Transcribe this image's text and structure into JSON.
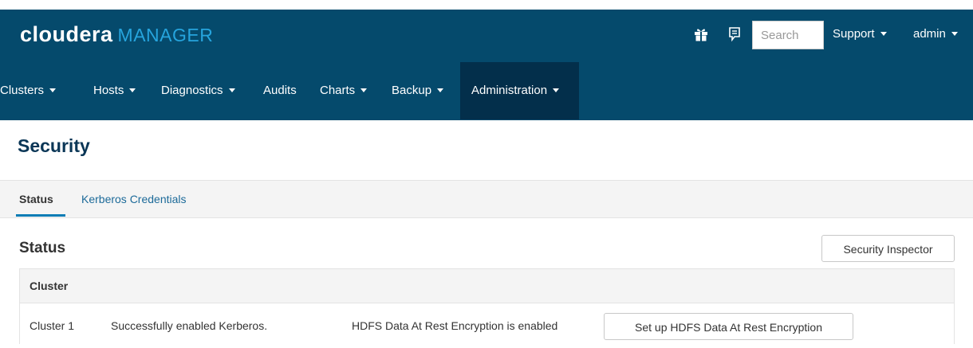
{
  "header": {
    "brand_main": "cloudera",
    "brand_product": "MANAGER",
    "search_placeholder": "Search",
    "support_label": "Support",
    "user_label": "admin",
    "icons": {
      "gift": "gift-icon",
      "notifications": "notification-icon"
    }
  },
  "nav": {
    "items": [
      {
        "label": "Clusters"
      },
      {
        "label": "Hosts"
      },
      {
        "label": "Diagnostics"
      },
      {
        "label": "Audits"
      },
      {
        "label": "Charts"
      },
      {
        "label": "Backup"
      },
      {
        "label": "Administration"
      }
    ],
    "active": "Administration"
  },
  "page": {
    "title": "Security",
    "tabs": [
      {
        "label": "Status"
      },
      {
        "label": "Kerberos Credentials"
      }
    ],
    "active_tab": "Status"
  },
  "status": {
    "title": "Status",
    "inspector_button": "Security Inspector",
    "table": {
      "header": "Cluster",
      "rows": [
        {
          "cluster": "Cluster 1",
          "kerberos": "Successfully enabled Kerberos.",
          "hdfs": "HDFS Data At Rest Encryption is enabled",
          "action": "Set up HDFS Data At Rest Encryption"
        }
      ]
    }
  },
  "colors": {
    "header_bg": "#054a6c",
    "active_nav_bg": "#032f4b",
    "brand_accent": "#26a4dd",
    "link": "#1c6a99",
    "title": "#0a3656"
  }
}
